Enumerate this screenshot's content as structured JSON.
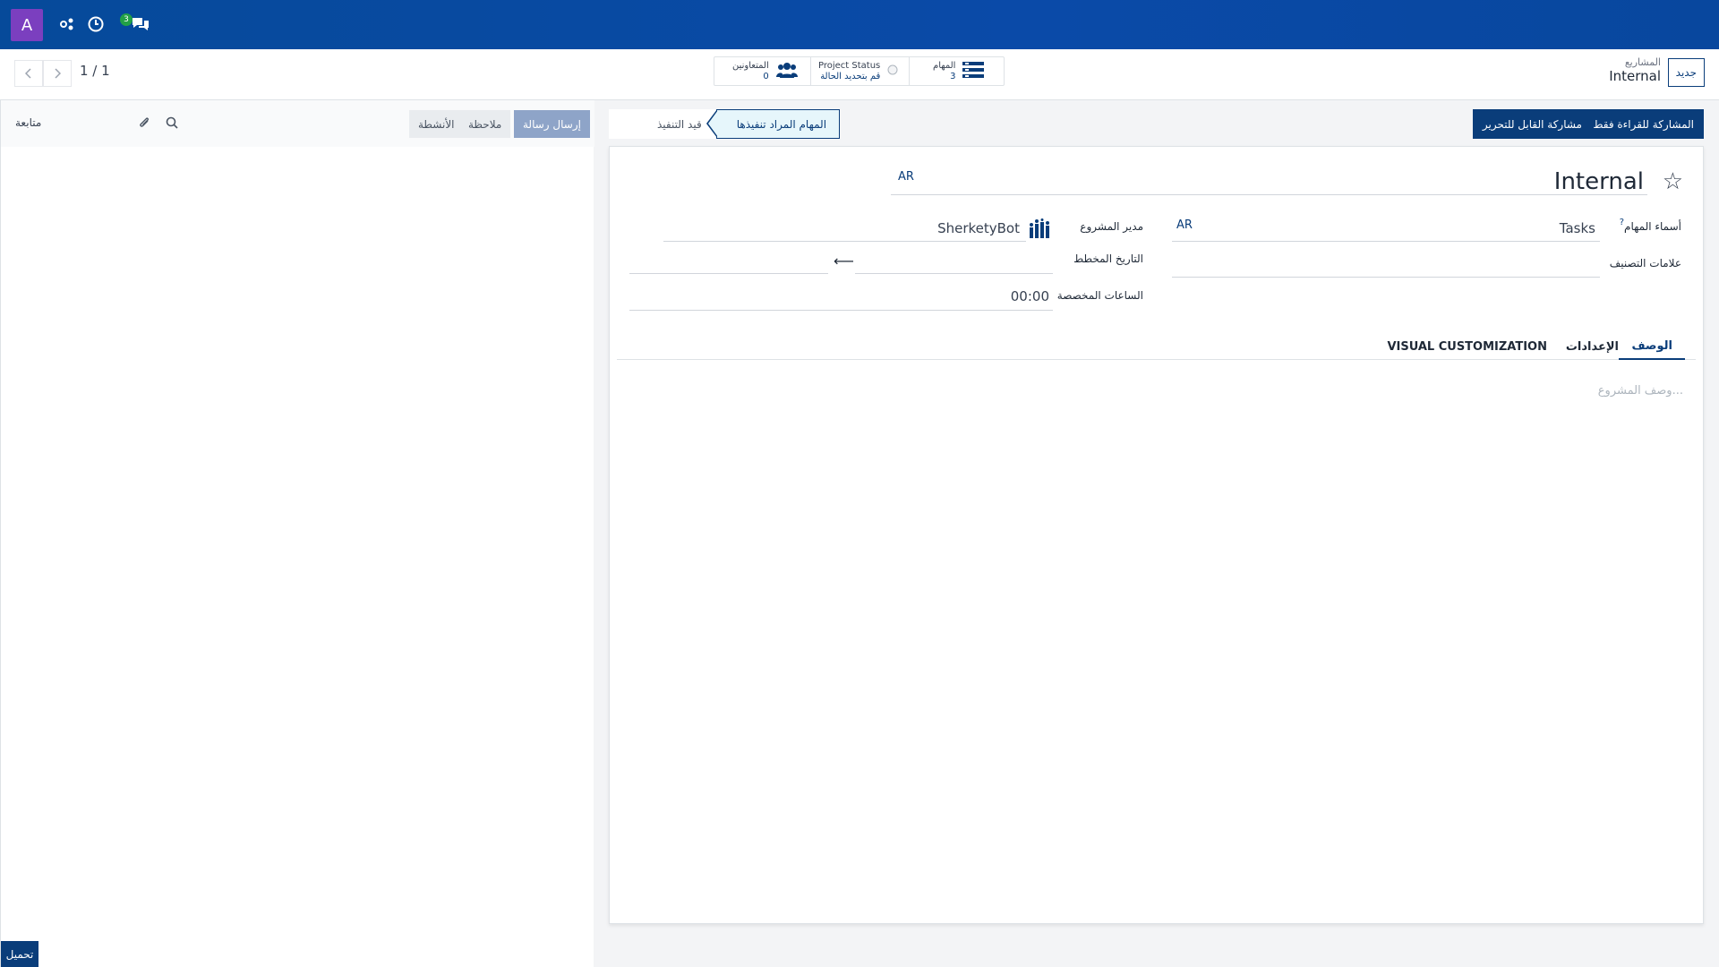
{
  "navbar": {
    "avatar_letter": "A",
    "icons": [
      "settings-share-icon",
      "clock-icon",
      "chat-icon"
    ],
    "chat_badge": "3"
  },
  "control_panel": {
    "pager": "1 / 1",
    "stats": {
      "tasks_label": "المهام",
      "tasks_value": "3",
      "status_label": "Project Status",
      "status_value": "قم بتحديد الحالة",
      "collaborators_label": "المتعاونين",
      "collaborators_value": "0"
    },
    "breadcrumb_parent": "المشاريع",
    "breadcrumb_current": "Internal",
    "new_button": "جديد"
  },
  "form_toolbar": {
    "share_readonly": "المشاركة للقراءة فقط",
    "share_editable": "مشاركة القابل للتحرير",
    "stage_active": "المهام المراد تنفيذها",
    "stage_inactive": "قيد التنفيذ"
  },
  "form": {
    "title": "Internal",
    "lang_tag": "AR",
    "task_names_label": "أسماء المهام",
    "task_names_help": "?",
    "task_names_value": "Tasks",
    "task_names_lang": "AR",
    "tags_label": "علامات التصنيف",
    "manager_label": "مدير المشروع",
    "manager_value": "SherketyBot",
    "planned_date_label": "التاريخ المخطط",
    "date_arrow": "⟵",
    "allocated_hours_label": "الساعات المخصصة",
    "allocated_hours_value": "00:00",
    "tabs": [
      "الوصف",
      "الإعدادات",
      "VISUAL CUSTOMIZATION"
    ],
    "description_placeholder": "وصف المشروع..."
  },
  "chatter": {
    "send_message": "إرسال رسالة",
    "note": "ملاحظة",
    "activities": "الأنشطة",
    "follow": "متابعة"
  },
  "download_button": "تحميل",
  "colors": {
    "navbar": "#0a4aa8",
    "primary": "#0a3d7a",
    "avatar": "#7b3fbf",
    "badge": "#22a046"
  }
}
